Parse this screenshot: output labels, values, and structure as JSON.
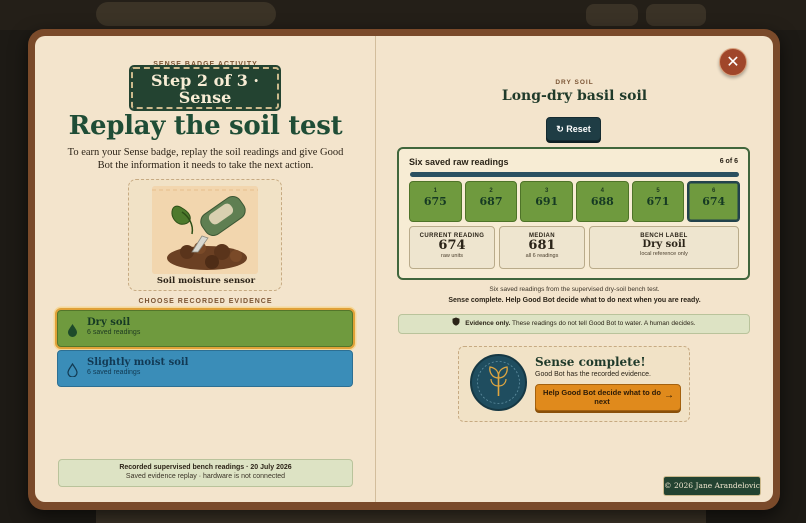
{
  "left": {
    "eyebrow": "SENSE BADGE ACTIVITY",
    "step_badge": "Step 2 of 3 · Sense",
    "title": "Replay the soil test",
    "description": "To earn your Sense badge, replay the soil readings and give Good Bot the information it needs to take the next action.",
    "sensor_caption": "Soil moisture sensor",
    "choose_label": "CHOOSE RECORDED EVIDENCE",
    "options": [
      {
        "title": "Dry soil",
        "sub": "6 saved readings",
        "selected": true,
        "icon": "soil-drop-icon",
        "color": "#6f9a3e"
      },
      {
        "title": "Slightly moist soil",
        "sub": "6 saved readings",
        "selected": false,
        "icon": "leaf-drop-icon",
        "color": "#3a8db8"
      }
    ],
    "record_title": "Recorded supervised bench readings · 20 July 2026",
    "record_sub": "Saved evidence replay · hardware is not connected"
  },
  "right": {
    "close_icon": "close-icon",
    "eyebrow": "DRY SOIL",
    "title": "Long-dry basil soil",
    "reset_label": "Reset",
    "readings_title": "Six saved raw readings",
    "readings_count": "6 of 6",
    "progress": 1.0,
    "tiles": [
      {
        "index": "1",
        "value": "675"
      },
      {
        "index": "2",
        "value": "687"
      },
      {
        "index": "3",
        "value": "691"
      },
      {
        "index": "4",
        "value": "688"
      },
      {
        "index": "5",
        "value": "671"
      },
      {
        "index": "6",
        "value": "674"
      }
    ],
    "current": {
      "label": "CURRENT READING",
      "value": "674",
      "sub": "raw units"
    },
    "median": {
      "label": "MEDIAN",
      "value": "681",
      "sub": "all 6 readings"
    },
    "bench": {
      "label": "BENCH LABEL",
      "value": "Dry soil",
      "sub": "local reference only"
    },
    "caption1": "Six saved readings from the supervised dry-soil bench test.",
    "caption2": "Sense complete. Help Good Bot decide what to do next when you are ready.",
    "evidence_bold": "Evidence only.",
    "evidence_rest": " These readings do not tell Good Bot to water. A human decides.",
    "complete_title": "Sense complete!",
    "complete_sub": "Good Bot has the recorded evidence.",
    "help_button": "Help Good Bot decide what to do next"
  },
  "copyright": "© 2026 Jane Arandelovic",
  "colors": {
    "accent_green": "#1f4d36",
    "dry_option": "#6f9a3e",
    "moist_option": "#3a8db8",
    "action_orange": "#e08a1c"
  }
}
